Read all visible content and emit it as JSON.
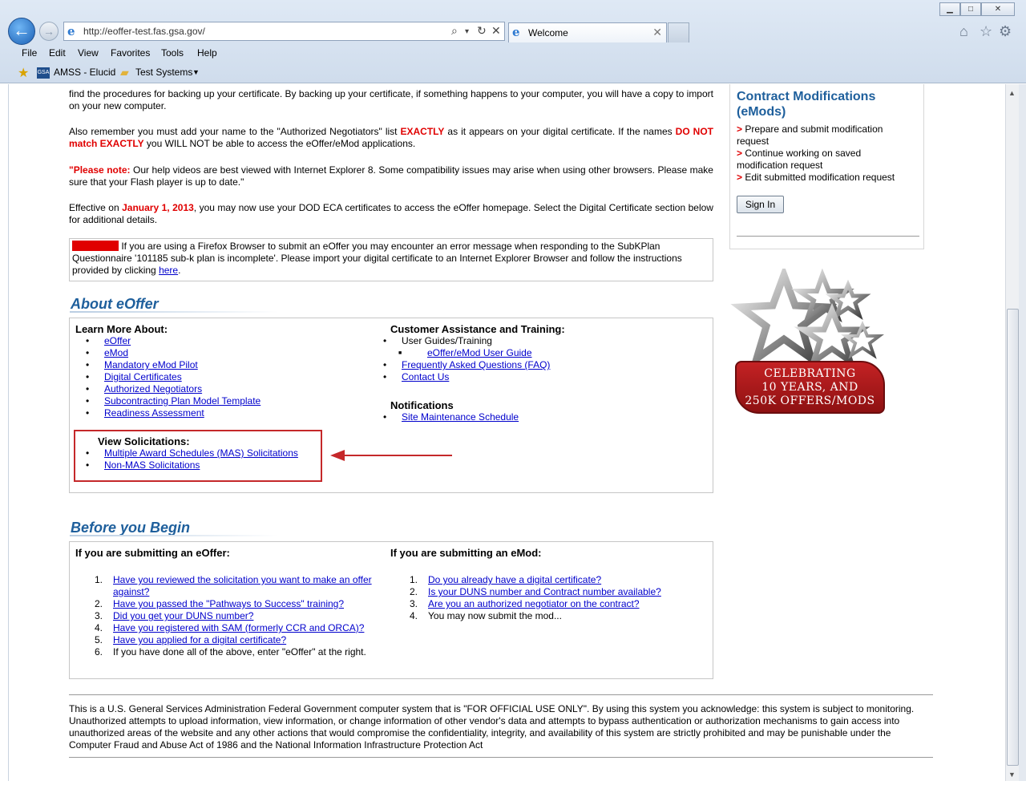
{
  "browser": {
    "address": "http://eoffer-test.fas.gsa.gov/",
    "tab_title": "Welcome",
    "menu": [
      "File",
      "Edit",
      "View",
      "Favorites",
      "Tools",
      "Help"
    ],
    "favorites": [
      "AMSS - Elucid",
      "Test Systems"
    ]
  },
  "intro": {
    "p1": "find the procedures for backing up your certificate. By backing up your certificate, if something happens to your computer, you will have a copy to import on your new computer.",
    "p2_a": "Also remember you must add your name to the \"Authorized Negotiators\" list ",
    "p2_exactly": "EXACTLY",
    "p2_b": " as it appears on your digital certificate. If the names ",
    "p2_donot": "DO NOT match EXACTLY",
    "p2_c": " you WILL NOT be able to access the eOffer/eMod applications.",
    "p3_note": "\"Please note:",
    "p3_text": " Our help videos are best viewed with Internet Explorer 8. Some compatibility issues may arise when using other browsers. Please make sure that your Flash player is up to date.\"",
    "p4_a": "Effective on ",
    "p4_date": "January 1, 2013",
    "p4_b": ", you may now use your DOD ECA certificates to access the eOffer homepage. Select the Digital Certificate section below for additional details.",
    "notice_text": " If you are using a Firefox Browser to submit an eOffer you may encounter an error message when responding to the SubKPlan Questionnaire '101185 sub-k plan is incomplete'. Please import your digital certificate to an Internet Explorer Browser and follow the instructions provided by clicking ",
    "notice_link": "here",
    "notice_end": "."
  },
  "about": {
    "heading": "About eOffer",
    "learn_title": "Learn More About:",
    "learn_links": [
      "eOffer",
      "eMod",
      "Mandatory eMod Pilot",
      "Digital Certificates",
      "Authorized Negotiators",
      "Subcontracting Plan Model Template",
      "Readiness Assessment"
    ],
    "solicit_title": "View Solicitations:",
    "solicit_links": [
      "Multiple Award Schedules (MAS) Solicitations",
      "Non-MAS Solicitations"
    ],
    "cust_title": "Customer Assistance and Training:",
    "cust_guides": "User Guides/Training",
    "cust_guide_link": "eOffer/eMod User Guide",
    "cust_links": [
      "Frequently Asked Questions (FAQ)",
      "Contact Us"
    ],
    "notif_title": "Notifications",
    "notif_link": "Site Maintenance Schedule"
  },
  "before": {
    "heading": "Before you Begin",
    "eoffer_title": "If you are submitting an eOffer:",
    "eoffer_steps": [
      {
        "num": "1.",
        "text": "Have you reviewed the solicitation you want to make an offer against?",
        "link": true
      },
      {
        "num": "2.",
        "text": "Have you passed the \"Pathways to Success\" training?",
        "link": true
      },
      {
        "num": "3.",
        "text": "Did you get your DUNS number?",
        "link": true
      },
      {
        "num": "4.",
        "text": "Have you registered with SAM (formerly CCR and ORCA)?",
        "link": true
      },
      {
        "num": "5.",
        "text": "Have you applied for a digital certificate?",
        "link": true
      },
      {
        "num": "6.",
        "text": "If you have done all of the above, enter \"eOffer\" at the right.",
        "link": false
      }
    ],
    "emod_title": "If you are submitting an eMod:",
    "emod_steps": [
      {
        "num": "1.",
        "text": "Do you already have a digital certificate?",
        "link": true
      },
      {
        "num": "2.",
        "text": "Is your DUNS number and Contract number available?",
        "link": true
      },
      {
        "num": "3.",
        "text": "Are you an authorized negotiator on the contract?",
        "link": true
      },
      {
        "num": "4.",
        "text": "You may now submit the mod...",
        "link": false
      }
    ]
  },
  "emods_panel": {
    "title": "Contract Modifications (eMods)",
    "gt": ">",
    "items": [
      "Prepare and submit modification request",
      "Continue working on saved modification request",
      "Edit submitted modification request"
    ],
    "signin": "Sign In"
  },
  "badge": {
    "banner": [
      "CELEBRATING",
      "10 YEARS, AND",
      "250K OFFERS/MODS"
    ]
  },
  "footer": {
    "text": "This is a U.S. General Services Administration Federal Government computer system that is \"FOR OFFICIAL USE ONLY\". By using this system you acknowledge: this system is subject to monitoring. Unauthorized attempts to upload information, view information, or change information of other vendor's data and attempts to bypass authentication or authorization mechanisms to gain access into unauthorized areas of the website and any other actions that would compromise the confidentiality, integrity, and availability of this system are strictly prohibited and may be punishable under the Computer Fraud and Abuse Act of 1986 and the National Information Infrastructure Protection Act"
  },
  "colors": {
    "accent": "#1e5f9c",
    "alert": "#e00000",
    "link": "#0000cc",
    "highlight": "#c5282a"
  }
}
